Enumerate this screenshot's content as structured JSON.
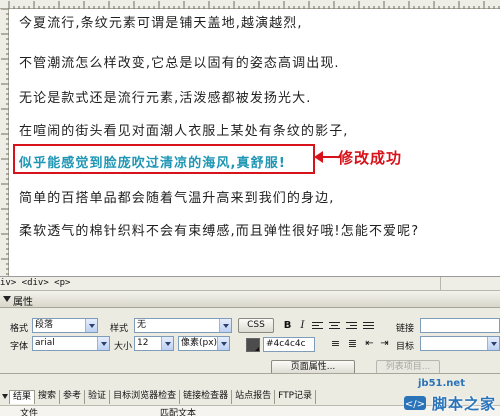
{
  "document": {
    "paragraphs": [
      "今夏流行,条纹元素可谓是铺天盖地,越演越烈,",
      "不管潮流怎么样改变,它总是以固有的姿态高调出现.",
      "无论是款式还是流行元素,活泼感都被发扬光大.",
      "在喧闹的街头看见对面潮人衣服上某处有条纹的影子,",
      "似乎能感觉到脸庞吹过清凉的海风,真舒服!",
      "简单的百搭单品都会随着气温升高来到我们的身边,",
      "柔软透气的棉针织料不会有束缚感,而且弹性很好哦!怎能不爱呢?"
    ],
    "highlight_color": "#1e96b4",
    "annotation": {
      "text": "修改成功",
      "color": "#d8121b"
    }
  },
  "tag_selector": {
    "path": "iv> <div> <p>"
  },
  "properties": {
    "title": "属性",
    "format_label": "格式",
    "format_value": "段落",
    "style_label": "样式",
    "style_value": "无",
    "css_button": "CSS",
    "bold_glyph": "B",
    "italic_glyph": "I",
    "link_label": "链接",
    "font_label": "字体",
    "font_value": "arial",
    "size_label": "大小",
    "size_value": "12",
    "unit_value": "像素(px)",
    "color_value": "#4c4c4c",
    "color_swatch": "#4c4c4c",
    "target_label": "目标",
    "page_props_button": "页面属性...",
    "list_item_button": "列表项目..."
  },
  "results": {
    "tabs": [
      "结果",
      "搜索",
      "参考",
      "验证",
      "目标浏览器检查",
      "链接检查器",
      "站点报告",
      "FTP记录"
    ],
    "active_tab": 0,
    "columns": [
      "文件",
      "匹配文本"
    ]
  },
  "watermark": {
    "url": "jb51.net",
    "name": "脚本之家"
  }
}
